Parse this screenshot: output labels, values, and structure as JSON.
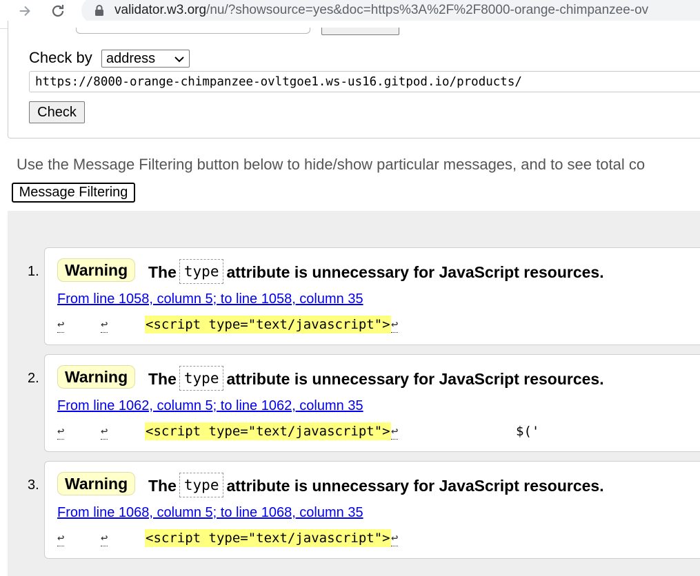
{
  "browser": {
    "url_host": "validator.w3.org",
    "url_rest": "/nu/?showsource=yes&doc=https%3A%2F%2F8000-orange-chimpanzee-ov"
  },
  "form": {
    "checkby_label": "Check by",
    "checkby_value": "address",
    "url_value": "https://8000-orange-chimpanzee-ovltgoe1.ws-us16.gitpod.io/products/",
    "check_button": "Check"
  },
  "instructions": "Use the Message Filtering button below to hide/show particular messages, and to see total co",
  "filter_button": "Message Filtering",
  "messages": [
    {
      "num": "1.",
      "type": "Warning",
      "pre": "The",
      "code": "type",
      "post": "attribute is unnecessary for JavaScript resources.",
      "location": "From line 1058, column 5; to line 1058, column 35",
      "lf1": "↩",
      "lf2": "↩",
      "extract": "<script type=\"text/javascript\">",
      "lf3": "↩",
      "trail": ""
    },
    {
      "num": "2.",
      "type": "Warning",
      "pre": "The",
      "code": "type",
      "post": "attribute is unnecessary for JavaScript resources.",
      "location": "From line 1062, column 5; to line 1062, column 35",
      "lf1": "↩",
      "lf2": "↩",
      "extract": "<script type=\"text/javascript\">",
      "lf3": "↩",
      "trail": "$('"
    },
    {
      "num": "3.",
      "type": "Warning",
      "pre": "The",
      "code": "type",
      "post": "attribute is unnecessary for JavaScript resources.",
      "location": "From line 1068, column 5; to line 1068, column 35",
      "lf1": "↩",
      "lf2": "↩",
      "extract": "<script type=\"text/javascript\">",
      "lf3": "↩",
      "trail": ""
    }
  ],
  "icons": {
    "forward": "arrow-right-icon",
    "reload": "reload-icon",
    "lock": "lock-icon",
    "dropdown": "chevron-down-icon"
  },
  "colors": {
    "warning_bg": "#ffffcc",
    "highlight": "#ffff80",
    "link": "#0000ee",
    "results_bg": "#eeeeee"
  }
}
